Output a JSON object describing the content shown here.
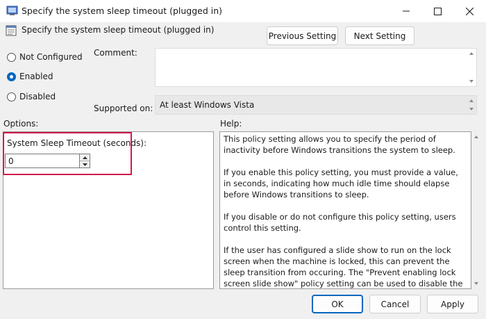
{
  "window": {
    "title": "Specify the system sleep timeout (plugged in)",
    "controls": {
      "minimize": "—",
      "maximize": "☐",
      "close": "✕"
    }
  },
  "header": {
    "policy_name": "Specify the system sleep timeout (plugged in)",
    "previous_label": "Previous Setting",
    "next_label": "Next Setting"
  },
  "state": {
    "options": [
      {
        "label": "Not Configured",
        "selected": false
      },
      {
        "label": "Enabled",
        "selected": true
      },
      {
        "label": "Disabled",
        "selected": false
      }
    ]
  },
  "comment": {
    "label": "Comment:",
    "value": ""
  },
  "supported": {
    "label": "Supported on:",
    "value": "At least Windows Vista"
  },
  "options_panel": {
    "heading": "Options:",
    "setting_label": "System Sleep Timeout (seconds):",
    "setting_value": "0"
  },
  "help_panel": {
    "heading": "Help:",
    "paragraphs": [
      "This policy setting allows you to specify the period of inactivity before Windows transitions the system to sleep.",
      "If you enable this policy setting, you must provide a value, in seconds, indicating how much idle time should elapse before Windows transitions to sleep.",
      "If you disable or do not configure this policy setting, users control this setting.",
      "If the user has configured a slide show to run on the lock screen when the machine is locked, this can prevent the sleep transition from occuring.  The \"Prevent enabling lock screen slide show\" policy setting can be used to disable the slide show feature."
    ]
  },
  "footer": {
    "ok_label": "OK",
    "cancel_label": "Cancel",
    "apply_label": "Apply"
  },
  "colors": {
    "accent": "#0067c0",
    "highlight": "#d11a4a",
    "background": "#f0f0f0"
  }
}
